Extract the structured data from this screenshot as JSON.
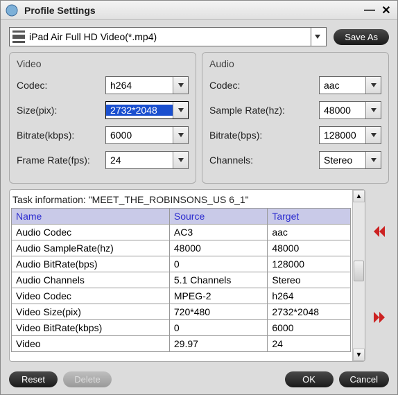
{
  "title": "Profile Settings",
  "profile": "iPad Air Full HD Video(*.mp4)",
  "buttons": {
    "saveAs": "Save As",
    "reset": "Reset",
    "delete": "Delete",
    "ok": "OK",
    "cancel": "Cancel"
  },
  "video": {
    "legend": "Video",
    "codec_label": "Codec:",
    "codec_value": "h264",
    "size_label": "Size(pix):",
    "size_value": "2732*2048",
    "bitrate_label": "Bitrate(kbps):",
    "bitrate_value": "6000",
    "framerate_label": "Frame Rate(fps):",
    "framerate_value": "24"
  },
  "audio": {
    "legend": "Audio",
    "codec_label": "Codec:",
    "codec_value": "aac",
    "samplerate_label": "Sample Rate(hz):",
    "samplerate_value": "48000",
    "bitrate_label": "Bitrate(bps):",
    "bitrate_value": "128000",
    "channels_label": "Channels:",
    "channels_value": "Stereo"
  },
  "task": {
    "title": "Task information: \"MEET_THE_ROBINSONS_US 6_1\"",
    "headers": {
      "name": "Name",
      "source": "Source",
      "target": "Target"
    },
    "rows": [
      {
        "name": "Audio Codec",
        "source": "AC3",
        "target": "aac"
      },
      {
        "name": "Audio SampleRate(hz)",
        "source": "48000",
        "target": "48000"
      },
      {
        "name": "Audio BitRate(bps)",
        "source": "0",
        "target": "128000"
      },
      {
        "name": "Audio Channels",
        "source": "5.1 Channels",
        "target": "Stereo"
      },
      {
        "name": "Video Codec",
        "source": "MPEG-2",
        "target": "h264"
      },
      {
        "name": "Video Size(pix)",
        "source": "720*480",
        "target": "2732*2048"
      },
      {
        "name": "Video BitRate(kbps)",
        "source": "0",
        "target": "6000"
      },
      {
        "name": "Video",
        "source": "29.97",
        "target": "24"
      }
    ]
  }
}
